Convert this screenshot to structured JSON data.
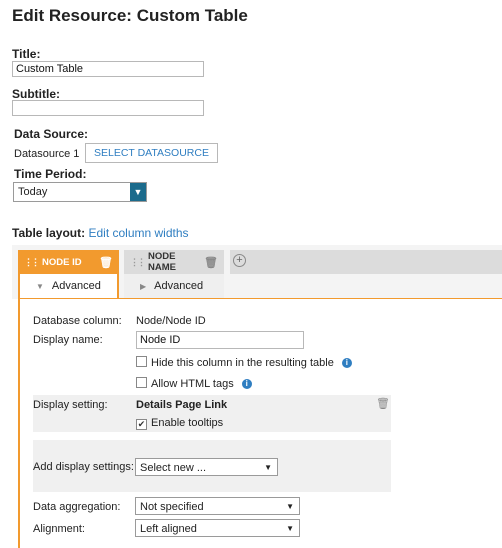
{
  "page": {
    "title": "Edit Resource: Custom Table"
  },
  "form": {
    "title_label": "Title:",
    "title_value": "Custom Table",
    "subtitle_label": "Subtitle:",
    "subtitle_value": "",
    "datasource_label": "Data Source:",
    "datasource_value": "Datasource 1",
    "select_datasource_label": "SELECT DATASOURCE",
    "timeperiod_label": "Time Period:",
    "timeperiod_value": "Today"
  },
  "table_layout": {
    "label": "Table layout:",
    "edit_link": "Edit column widths",
    "columns": [
      {
        "title": "NODE ID",
        "sub": "Advanced",
        "active": true
      },
      {
        "title": "NODE NAME",
        "sub": "Advanced",
        "active": false
      }
    ]
  },
  "details": {
    "db_column_label": "Database column:",
    "db_column_value": "Node/Node ID",
    "display_name_label": "Display name:",
    "display_name_value": "Node ID",
    "hide_column_label": "Hide this column in the resulting table",
    "allow_html_label": "Allow HTML tags",
    "display_setting_label": "Display setting:",
    "display_setting_value": "Details Page Link",
    "enable_tooltips_label": "Enable tooltips",
    "add_display_label": "Add display settings:",
    "add_display_value": "Select new ...",
    "aggregation_label": "Data aggregation:",
    "aggregation_value": "Not specified",
    "alignment_label": "Alignment:",
    "alignment_value": "Left aligned"
  },
  "colors": {
    "accent": "#f29a2e",
    "link": "#2f7ec1",
    "select_arrow": "#1b6b8c"
  }
}
